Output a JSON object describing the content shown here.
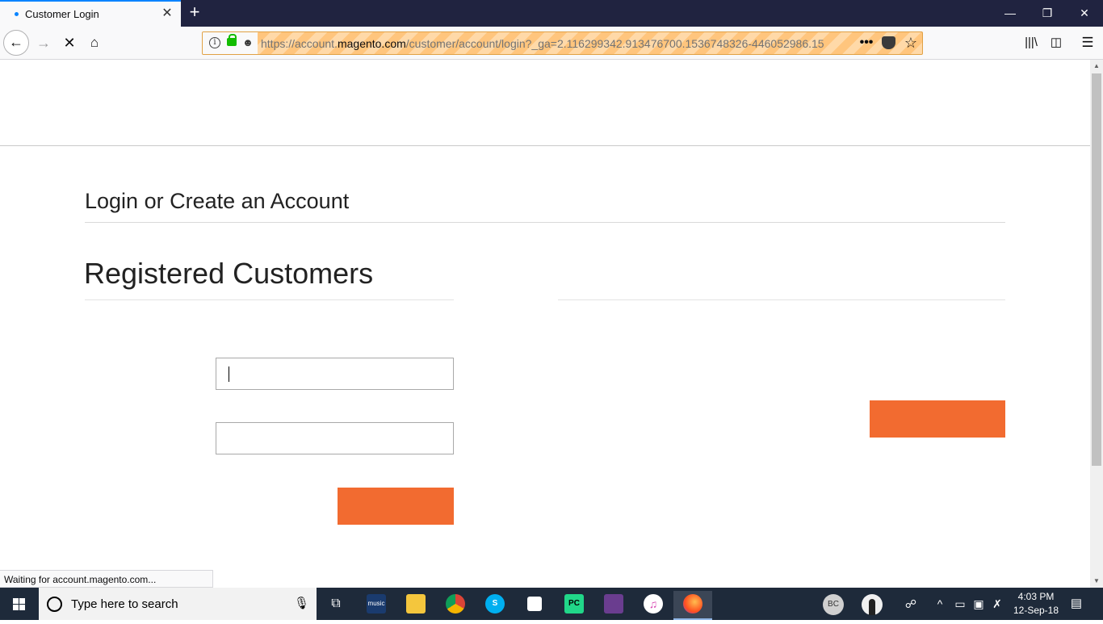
{
  "browser": {
    "tab_title": "Customer Login",
    "new_tab_label": "+",
    "url_prefix": "https://account.",
    "url_domain": "magento.com",
    "url_path": "/customer/account/login?_ga=2.116299342.913476700.1536748326-446052986.15",
    "more_label": "•••",
    "status_text": "Waiting for account.magento.com..."
  },
  "page": {
    "title": "Login or Create an Account",
    "section_title": "Registered Customers",
    "login_button_label": "",
    "create_button_label": ""
  },
  "taskbar": {
    "search_placeholder": "Type here to search",
    "music_label": "music",
    "pycharm_label": "PC",
    "user_initials": "BC",
    "time": "4:03 PM",
    "date": "12-Sep-18"
  },
  "colors": {
    "accent_button": "#f26b30",
    "tab_highlight": "#0a84ff",
    "taskbar_bg": "#1e2a3a"
  }
}
